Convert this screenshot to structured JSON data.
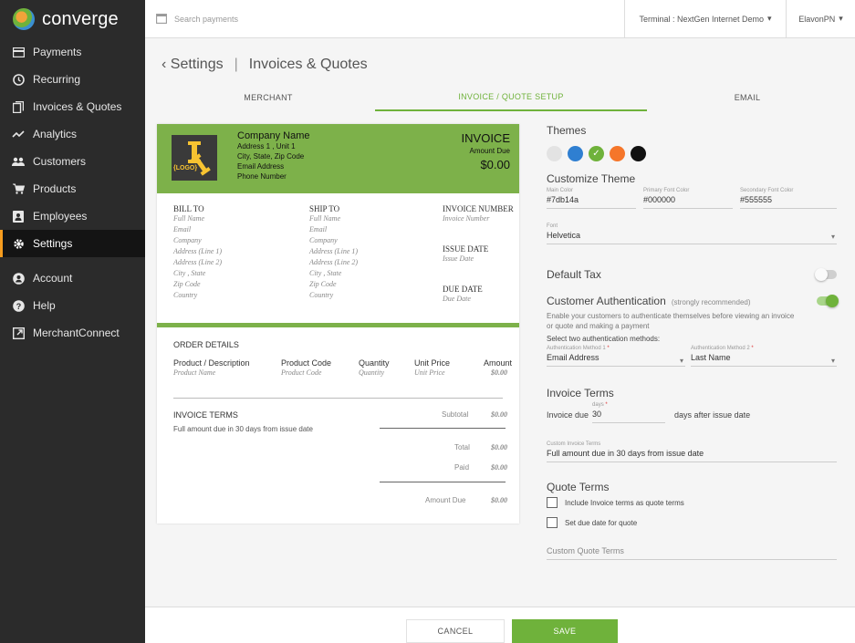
{
  "app": {
    "logo_text": "converge"
  },
  "sidebar": {
    "items": [
      {
        "label": "Payments",
        "icon": "credit-card-icon"
      },
      {
        "label": "Recurring",
        "icon": "clock-icon"
      },
      {
        "label": "Invoices & Quotes",
        "icon": "documents-icon"
      },
      {
        "label": "Analytics",
        "icon": "chart-line-icon"
      },
      {
        "label": "Customers",
        "icon": "users-icon"
      },
      {
        "label": "Products",
        "icon": "cart-icon"
      },
      {
        "label": "Employees",
        "icon": "id-card-icon"
      },
      {
        "label": "Settings",
        "icon": "gear-icon"
      }
    ],
    "bottom_items": [
      {
        "label": "Account",
        "icon": "user-circle-icon"
      },
      {
        "label": "Help",
        "icon": "help-icon"
      },
      {
        "label": "MerchantConnect",
        "icon": "external-link-icon"
      }
    ]
  },
  "topbar": {
    "search_placeholder": "Search payments",
    "terminal_label": "Terminal : NextGen Internet Demo",
    "user_label": "ElavonPN"
  },
  "page": {
    "back_label": "Settings",
    "separator": "|",
    "title": "Invoices & Quotes"
  },
  "tabs": [
    {
      "label": "MERCHANT"
    },
    {
      "label": "INVOICE / QUOTE SETUP"
    },
    {
      "label": "EMAIL"
    }
  ],
  "invoice": {
    "logo_text": "{LOGO}",
    "company_name": "Company Name",
    "address_line": "Address 1 , Unit 1",
    "city_line": "City, State, Zip Code",
    "email_line": "Email Address",
    "phone_line": "Phone Number",
    "title": "INVOICE",
    "amount_due_label": "Amount Due",
    "amount_due_value": "$0.00",
    "bill_to": {
      "heading": "BILL TO",
      "lines": [
        "Full Name",
        "Email",
        "Company",
        "Address (Line 1)",
        "Address (Line 2)",
        "City , State",
        "Zip Code",
        "Country"
      ]
    },
    "ship_to": {
      "heading": "SHIP TO",
      "lines": [
        "Full Name",
        "Email",
        "Company",
        "Address (Line 1)",
        "Address (Line 2)",
        "City , State",
        "Zip Code",
        "Country"
      ]
    },
    "meta": {
      "invoice_number_label": "INVOICE NUMBER",
      "invoice_number_value": "Invoice Number",
      "issue_date_label": "ISSUE DATE",
      "issue_date_value": "Issue Date",
      "due_date_label": "DUE DATE",
      "due_date_value": "Due Date"
    },
    "order": {
      "title": "ORDER DETAILS",
      "headers": [
        "Product / Description",
        "Product Code",
        "Quantity",
        "Unit Price",
        "Amount"
      ],
      "row": [
        "Product Name",
        "Product Code",
        "Quantity",
        "Unit Price",
        "$0.00"
      ]
    },
    "terms": {
      "title": "INVOICE TERMS",
      "text": "Full amount due in 30 days from issue date"
    },
    "totals": [
      {
        "label": "Subtotal",
        "value": "$0.00"
      },
      {
        "label": "Total",
        "value": "$0.00"
      },
      {
        "label": "Paid",
        "value": "$0.00"
      },
      {
        "label": "Amount Due",
        "value": "$0.00"
      }
    ]
  },
  "panel": {
    "themes_title": "Themes",
    "theme_colors": [
      "#e3e3e3",
      "#2f7fd1",
      "#6fb23b",
      "#f5762a",
      "#111111"
    ],
    "customize_title": "Customize Theme",
    "main_color_label": "Main Color",
    "main_color_value": "#7db14a",
    "primary_font_label": "Primary Font Color",
    "primary_font_value": "#000000",
    "secondary_font_label": "Secondary Font Color",
    "secondary_font_value": "#555555",
    "font_label": "Font",
    "font_value": "Helvetica",
    "default_tax_label": "Default Tax",
    "default_tax_on": false,
    "auth_title": "Customer Authentication",
    "auth_note": "(strongly recommended)",
    "auth_on": true,
    "auth_desc_1": "Enable your customers to authenticate themselves before viewing an invoice",
    "auth_desc_2": "or quote and making a payment",
    "auth_select_label": "Select two authentication methods:",
    "auth_method_1_label": "Authentication Method 1",
    "auth_method_1_value": "Email Address",
    "auth_method_2_label": "Authentication Method 2",
    "auth_method_2_value": "Last Name",
    "required_mark": "*",
    "invoice_terms_title": "Invoice Terms",
    "invoice_due_label": "Invoice due",
    "days_label": "days",
    "days_value": "30",
    "after_issue_label": "days after issue date",
    "custom_terms_label": "Custom Invoice Terms",
    "custom_terms_value": "Full amount due in 30 days from issue date",
    "quote_terms_title": "Quote Terms",
    "include_terms_label": "Include Invoice terms as quote terms",
    "set_due_label": "Set due date for quote",
    "custom_quote_placeholder": "Custom Quote Terms"
  },
  "footer": {
    "cancel_label": "CANCEL",
    "save_label": "SAVE"
  },
  "colors": {
    "accent_green": "#6fb23b",
    "invoice_green": "#7db14a",
    "sidebar_bg": "#2b2b2b",
    "active_marker": "#f59c1f"
  }
}
